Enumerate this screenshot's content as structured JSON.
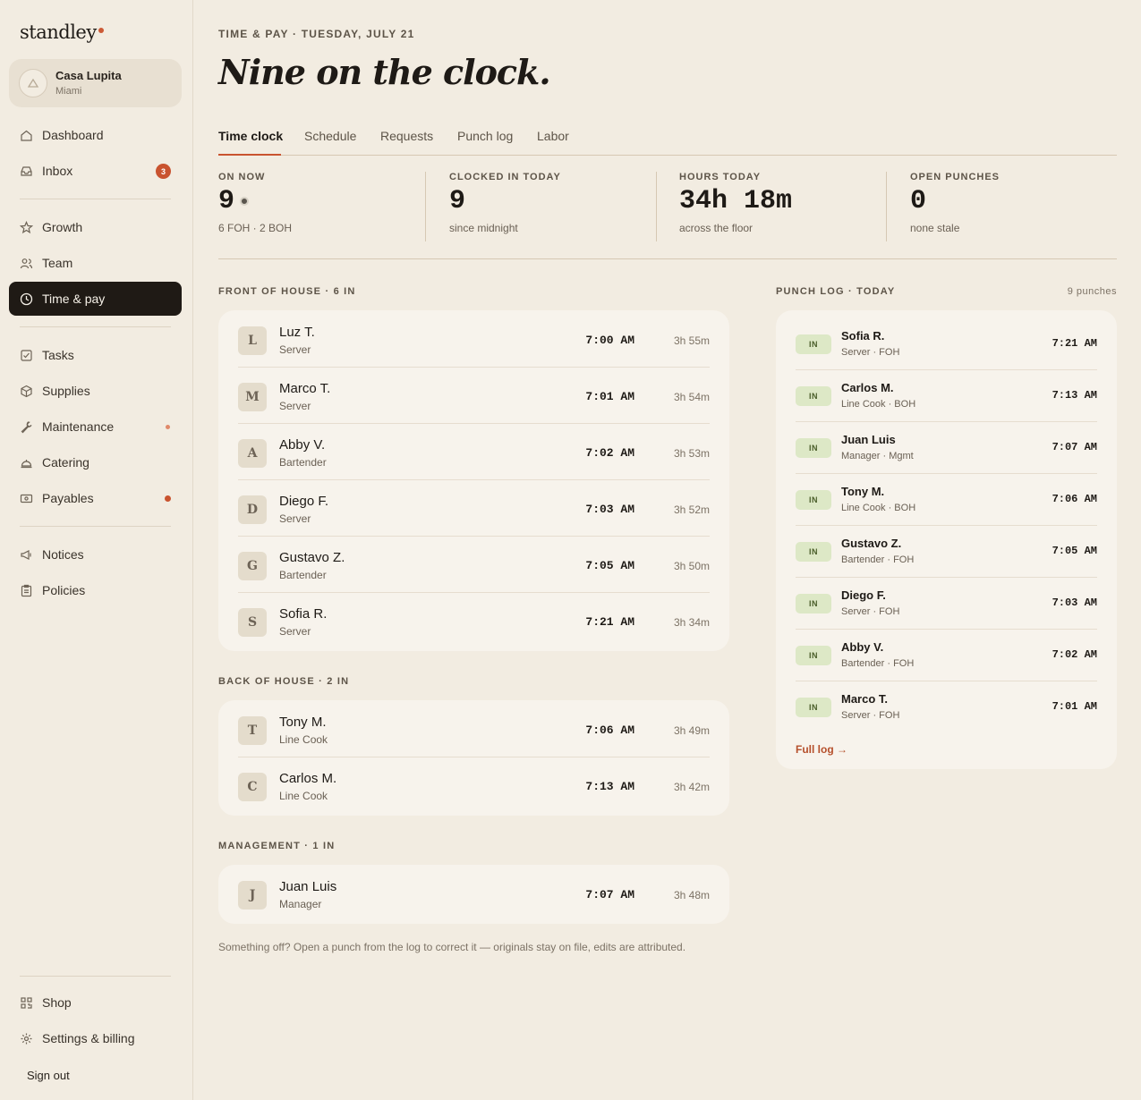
{
  "app": {
    "brand": "standley"
  },
  "org": {
    "name": "Casa Lupita",
    "city": "Miami"
  },
  "nav": {
    "dashboard": "Dashboard",
    "inbox": "Inbox",
    "inbox_badge": "3",
    "growth": "Growth",
    "team": "Team",
    "time_pay": "Time & pay",
    "tasks": "Tasks",
    "supplies": "Supplies",
    "maintenance": "Maintenance",
    "catering": "Catering",
    "payables": "Payables",
    "notices": "Notices",
    "policies": "Policies",
    "shop": "Shop",
    "settings": "Settings & billing",
    "signout": "Sign out"
  },
  "header": {
    "kicker": "TIME & PAY · TUESDAY, JULY 21",
    "title": "Nine on the clock."
  },
  "tabs": [
    "Time clock",
    "Schedule",
    "Requests",
    "Punch log",
    "Labor"
  ],
  "stats": [
    {
      "label": "ON NOW",
      "value": "9",
      "sub": "6 FOH · 2 BOH"
    },
    {
      "label": "CLOCKED IN TODAY",
      "value": "9",
      "sub": "since midnight"
    },
    {
      "label": "HOURS TODAY",
      "value": "34h 18m",
      "sub": "across the floor"
    },
    {
      "label": "OPEN PUNCHES",
      "value": "0",
      "sub": "none stale"
    }
  ],
  "foh": {
    "title": "FRONT OF HOUSE · 6 IN",
    "rows": [
      {
        "initial": "L",
        "name": "Luz T.",
        "role": "Server",
        "time": "7:00 AM",
        "duration": "3h 55m"
      },
      {
        "initial": "M",
        "name": "Marco T.",
        "role": "Server",
        "time": "7:01 AM",
        "duration": "3h 54m"
      },
      {
        "initial": "A",
        "name": "Abby V.",
        "role": "Bartender",
        "time": "7:02 AM",
        "duration": "3h 53m"
      },
      {
        "initial": "D",
        "name": "Diego F.",
        "role": "Server",
        "time": "7:03 AM",
        "duration": "3h 52m"
      },
      {
        "initial": "G",
        "name": "Gustavo Z.",
        "role": "Bartender",
        "time": "7:05 AM",
        "duration": "3h 50m"
      },
      {
        "initial": "S",
        "name": "Sofia R.",
        "role": "Server",
        "time": "7:21 AM",
        "duration": "3h 34m"
      }
    ]
  },
  "boh": {
    "title": "BACK OF HOUSE · 2 IN",
    "rows": [
      {
        "initial": "T",
        "name": "Tony M.",
        "role": "Line Cook",
        "time": "7:06 AM",
        "duration": "3h 49m"
      },
      {
        "initial": "C",
        "name": "Carlos M.",
        "role": "Line Cook",
        "time": "7:13 AM",
        "duration": "3h 42m"
      }
    ]
  },
  "mgmt": {
    "title": "MANAGEMENT · 1 IN",
    "rows": [
      {
        "initial": "J",
        "name": "Juan Luis",
        "role": "Manager",
        "time": "7:07 AM",
        "duration": "3h 48m"
      }
    ]
  },
  "punch_log": {
    "title": "PUNCH LOG · TODAY",
    "count": "9  punches",
    "badge": "IN",
    "rows": [
      {
        "name": "Sofia R.",
        "role": "Server · FOH",
        "time": "7:21 AM"
      },
      {
        "name": "Carlos M.",
        "role": "Line Cook · BOH",
        "time": "7:13 AM"
      },
      {
        "name": "Juan Luis",
        "role": "Manager · Mgmt",
        "time": "7:07 AM"
      },
      {
        "name": "Tony M.",
        "role": "Line Cook · BOH",
        "time": "7:06 AM"
      },
      {
        "name": "Gustavo Z.",
        "role": "Bartender · FOH",
        "time": "7:05 AM"
      },
      {
        "name": "Diego F.",
        "role": "Server · FOH",
        "time": "7:03 AM"
      },
      {
        "name": "Abby V.",
        "role": "Bartender · FOH",
        "time": "7:02 AM"
      },
      {
        "name": "Marco T.",
        "role": "Server · FOH",
        "time": "7:01 AM"
      }
    ],
    "full_log": "Full log →"
  },
  "footnote": "Something off? Open a punch from the log to correct it — originals stay on file, edits are attributed.",
  "colors": {
    "accent": "#c9532f",
    "in_badge_bg": "#dde8c6",
    "active_nav_bg": "#1f1a15"
  }
}
